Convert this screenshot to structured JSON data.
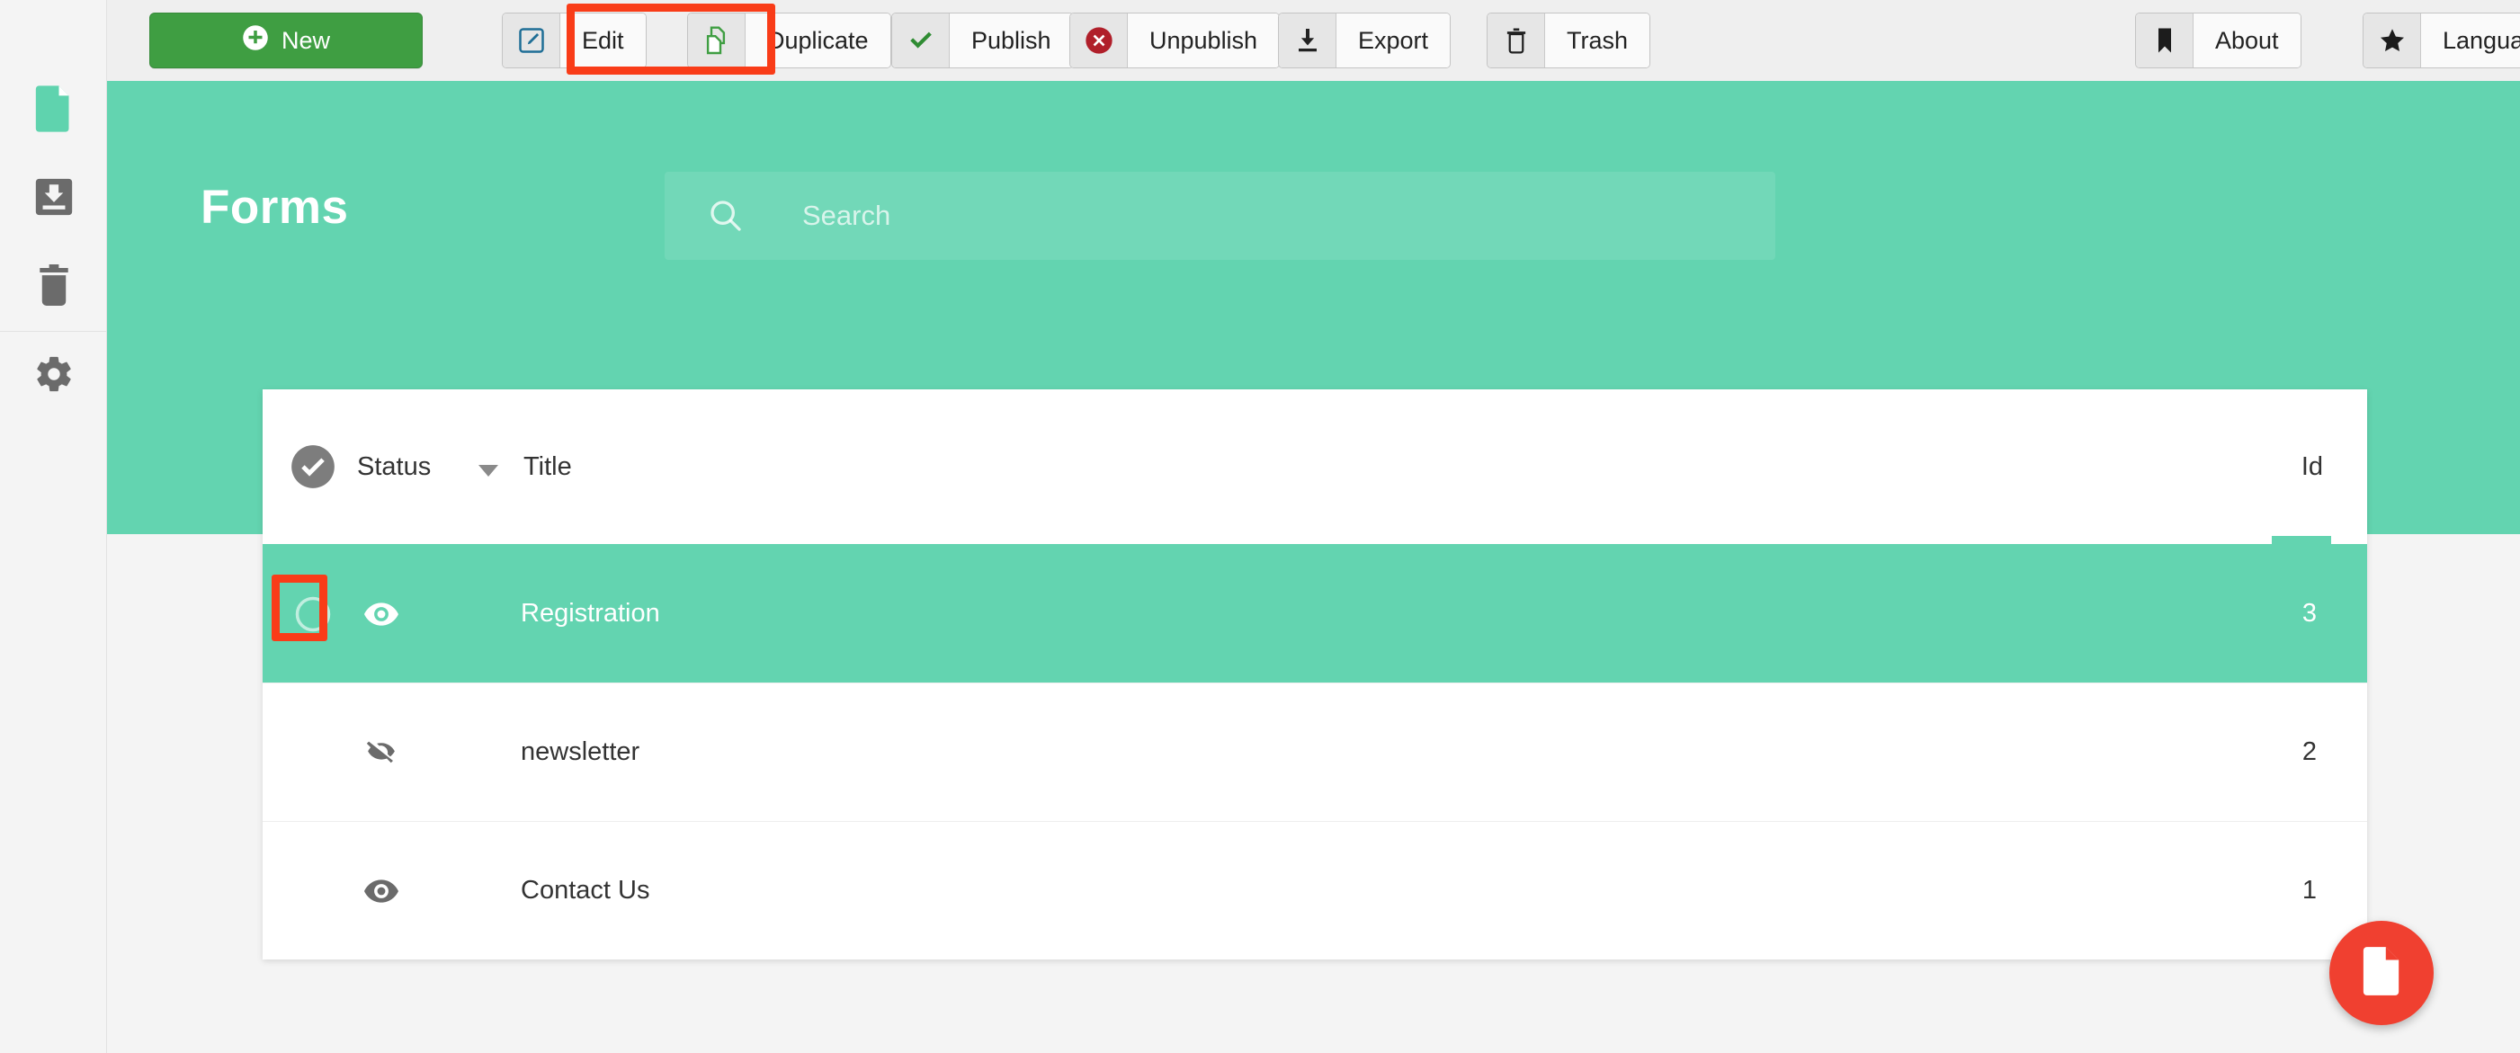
{
  "app": {
    "accent_teal": "#63d4b0",
    "accent_green": "#3f9e42",
    "accent_red": "#f04030",
    "highlight_red": "#f93c18",
    "toolbar_bg": "#efefef",
    "page_bg": "#f4f4f4"
  },
  "sidebar": {
    "items": [
      {
        "name": "document-icon",
        "label": "Forms",
        "active": true
      },
      {
        "name": "inbox-download-icon",
        "label": "Submissions",
        "active": false
      },
      {
        "name": "trash-icon",
        "label": "Trash",
        "active": false
      },
      {
        "name": "gear-icon",
        "label": "Settings",
        "active": false
      }
    ]
  },
  "toolbar": {
    "new_label": "New",
    "buttons": [
      {
        "label": "Edit",
        "icon": "edit-pencil-icon"
      },
      {
        "label": "Duplicate",
        "icon": "duplicate-copy-icon",
        "highlighted": true
      },
      {
        "label": "Publish",
        "icon": "check-icon"
      },
      {
        "label": "Unpublish",
        "icon": "circle-x-icon"
      },
      {
        "label": "Export",
        "icon": "download-icon"
      },
      {
        "label": "Trash",
        "icon": "trash-icon"
      }
    ],
    "right_buttons": [
      {
        "label": "About",
        "icon": "bookmark-icon"
      },
      {
        "label": "Language",
        "icon": "star-icon"
      }
    ]
  },
  "header": {
    "title": "Forms"
  },
  "search": {
    "placeholder": "Search",
    "value": "",
    "icon": "search-icon"
  },
  "table": {
    "columns": {
      "select_all": "select-all-checkbox",
      "status": "Status",
      "title": "Title",
      "id": "Id"
    },
    "sorted_column": "Id",
    "rows": [
      {
        "title": "Registration",
        "id": "3",
        "state_icon": "eye-visible-icon",
        "selected": true,
        "checkbox_highlighted": true
      },
      {
        "title": "newsletter",
        "id": "2",
        "state_icon": "eye-hidden-icon",
        "selected": false,
        "checkbox_highlighted": false
      },
      {
        "title": "Contact Us",
        "id": "1",
        "state_icon": "eye-visible-icon",
        "selected": false,
        "checkbox_highlighted": false
      }
    ]
  },
  "fab": {
    "icon": "new-document-icon",
    "label": "New form"
  }
}
